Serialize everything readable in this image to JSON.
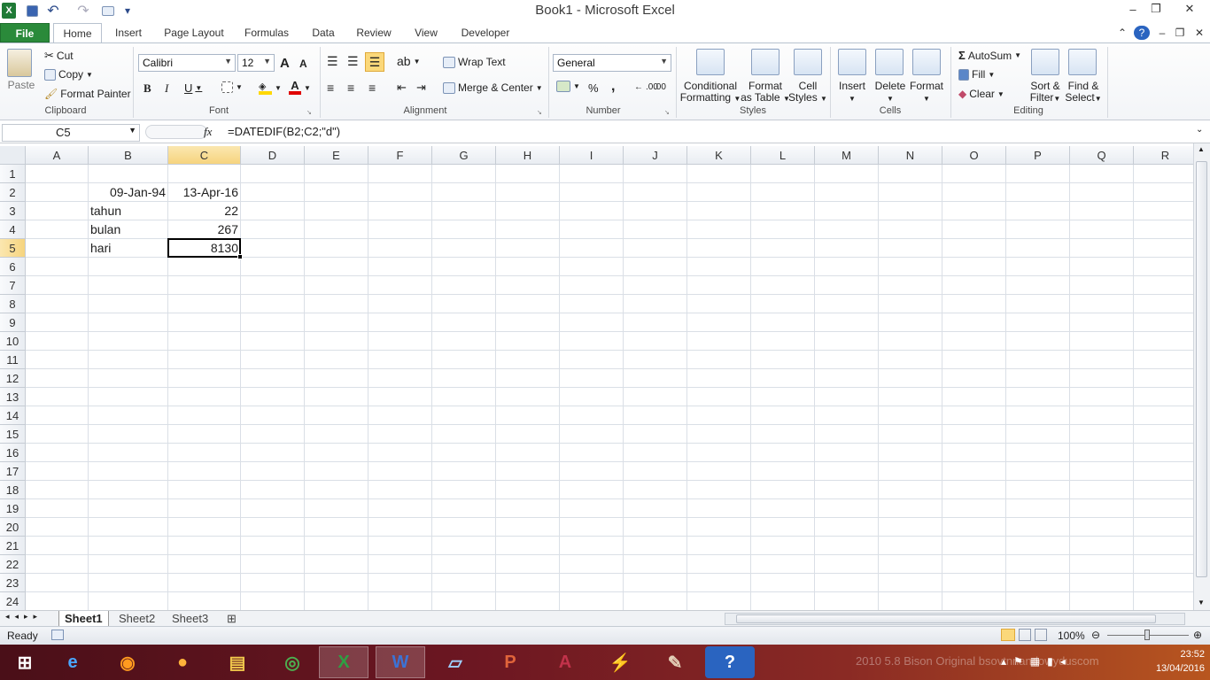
{
  "window": {
    "title": "Book1  -  Microsoft Excel",
    "minimize": "–",
    "restore": "❐",
    "close": "✕"
  },
  "qat": {
    "save": "💾",
    "undo": "↶",
    "redo": "↷",
    "customize": "▾"
  },
  "tabs": [
    "File",
    "Home",
    "Insert",
    "Page Layout",
    "Formulas",
    "Data",
    "Review",
    "View",
    "Developer"
  ],
  "ribbon": {
    "clipboard": {
      "paste": "Paste",
      "cut": "Cut",
      "copy": "Copy",
      "format_painter": "Format Painter",
      "label": "Clipboard"
    },
    "font": {
      "name": "Calibri",
      "size": "12",
      "bold": "B",
      "italic": "I",
      "underline": "U",
      "grow": "A",
      "shrink": "A",
      "label": "Font"
    },
    "alignment": {
      "wrap": "Wrap Text",
      "merge": "Merge & Center",
      "label": "Alignment"
    },
    "number": {
      "format": "General",
      "percent": "%",
      "comma": ",",
      "inc": ".00",
      "dec": ".00",
      "label": "Number"
    },
    "styles": {
      "conditional_1": "Conditional",
      "conditional_2": "Formatting",
      "format_table_1": "Format",
      "format_table_2": "as Table",
      "cell_styles_1": "Cell",
      "cell_styles_2": "Styles",
      "label": "Styles"
    },
    "cells": {
      "insert": "Insert",
      "delete": "Delete",
      "format": "Format",
      "label": "Cells"
    },
    "editing": {
      "autosum": "AutoSum",
      "fill": "Fill",
      "clear": "Clear",
      "sort_1": "Sort &",
      "sort_2": "Filter",
      "find_1": "Find &",
      "find_2": "Select",
      "label": "Editing"
    }
  },
  "formula_bar": {
    "name_box": "C5",
    "fx": "fx",
    "formula": "=DATEDIF(B2;C2;\"d\")"
  },
  "columns": [
    "A",
    "B",
    "C",
    "D",
    "E",
    "F",
    "G",
    "H",
    "I",
    "J",
    "K",
    "L",
    "M",
    "N",
    "O",
    "P",
    "Q",
    "R"
  ],
  "rows": [
    "1",
    "2",
    "3",
    "4",
    "5",
    "6",
    "7",
    "8",
    "9",
    "10",
    "11",
    "12",
    "13",
    "14",
    "15",
    "16",
    "17",
    "18",
    "19",
    "20",
    "21",
    "22",
    "23",
    "24"
  ],
  "cells": {
    "B2": "09-Jan-94",
    "C2": "13-Apr-16",
    "B3": "tahun",
    "C3": "22",
    "B4": "bulan",
    "C4": "267",
    "B5": "hari",
    "C5": "8130"
  },
  "sheets": [
    "Sheet1",
    "Sheet2",
    "Sheet3"
  ],
  "status": {
    "ready": "Ready",
    "zoom": "100%"
  },
  "taskbar": {
    "time": "23:52",
    "date": "13/04/2016",
    "watermark": "2010 5.8 Bison Original bsovtnnandowyduscom"
  }
}
